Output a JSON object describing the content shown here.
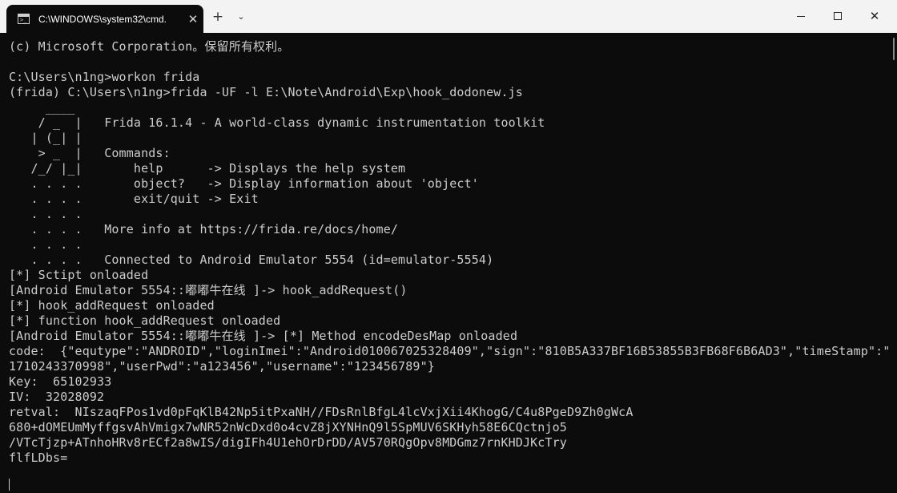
{
  "window": {
    "tab_title": "C:\\WINDOWS\\system32\\cmd.",
    "tab_close_glyph": "✕",
    "new_tab_glyph": "+",
    "dropdown_glyph": "⌄",
    "close_glyph": "✕",
    "tab_icon_prompt": ">_"
  },
  "terminal": {
    "lines": [
      "(c) Microsoft Corporation。保留所有权利。",
      "",
      "C:\\Users\\n1ng>workon frida",
      "(frida) C:\\Users\\n1ng>frida -UF -l E:\\Note\\Android\\Exp\\hook_dodonew.js",
      "     ____",
      "    / _  |   Frida 16.1.4 - A world-class dynamic instrumentation toolkit",
      "   | (_| |",
      "    > _  |   Commands:",
      "   /_/ |_|       help      -> Displays the help system",
      "   . . . .       object?   -> Display information about 'object'",
      "   . . . .       exit/quit -> Exit",
      "   . . . .",
      "   . . . .   More info at https://frida.re/docs/home/",
      "   . . . .",
      "   . . . .   Connected to Android Emulator 5554 (id=emulator-5554)",
      "[*] Sctipt onloaded",
      "[Android Emulator 5554::嘟嘟牛在线 ]-> hook_addRequest()",
      "[*] hook_addRequest onloaded",
      "[*] function hook_addRequest onloaded",
      "[Android Emulator 5554::嘟嘟牛在线 ]-> [*] Method encodeDesMap onloaded",
      "code:  {\"equtype\":\"ANDROID\",\"loginImei\":\"Android010067025328409\",\"sign\":\"810B5A337BF16B53855B3FB68F6B6AD3\",\"timeStamp\":\"",
      "1710243370998\",\"userPwd\":\"a123456\",\"username\":\"123456789\"}",
      "Key:  65102933",
      "IV:  32028092",
      "retval:  NIszaqFPos1vd0pFqKlB42Np5itPxaNH//FDsRnlBfgL4lcVxjXii4KhogG/C4u8PgeD9Zh0gWcA",
      "680+dOMEUmMyffgsvAhVmigx7wNR52nWcDxd0o4cvZ8jXYNHnQ9l5SpMUV6SKHyh58E6CQctnjo5",
      "/VTcTjzp+ATnhoHRv8rECf2a8wIS/digIFh4U1ehOrDrDD/AV570RQgOpv8MDGmz7rnKHDJKcTry",
      "flfLDbs="
    ]
  }
}
